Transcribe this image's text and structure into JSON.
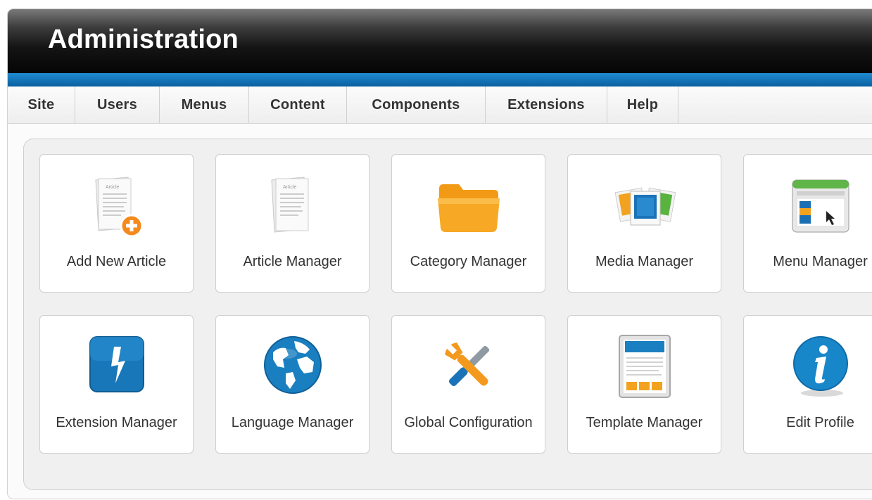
{
  "header": {
    "title": "Administration"
  },
  "menu": {
    "items": [
      {
        "label": "Site"
      },
      {
        "label": "Users"
      },
      {
        "label": "Menus"
      },
      {
        "label": "Content"
      },
      {
        "label": "Components"
      },
      {
        "label": "Extensions"
      },
      {
        "label": "Help"
      }
    ]
  },
  "tiles": [
    {
      "label": "Add New Article",
      "icon": "add-article-icon"
    },
    {
      "label": "Article Manager",
      "icon": "article-icon"
    },
    {
      "label": "Category Manager",
      "icon": "folder-icon"
    },
    {
      "label": "Media Manager",
      "icon": "media-icon"
    },
    {
      "label": "Menu Manager",
      "icon": "menu-window-icon"
    },
    {
      "label": "Extension Manager",
      "icon": "lightning-icon"
    },
    {
      "label": "Language Manager",
      "icon": "globe-icon"
    },
    {
      "label": "Global Configuration",
      "icon": "tools-icon"
    },
    {
      "label": "Template Manager",
      "icon": "template-icon"
    },
    {
      "label": "Edit Profile",
      "icon": "info-icon"
    }
  ],
  "icon_text": {
    "article_heading": "Article"
  },
  "colors": {
    "header_dark": "#050505",
    "stripe_blue": "#1478bc",
    "folder_orange": "#f7a21b",
    "add_badge_orange": "#f48a1d",
    "info_blue": "#1887c9"
  }
}
